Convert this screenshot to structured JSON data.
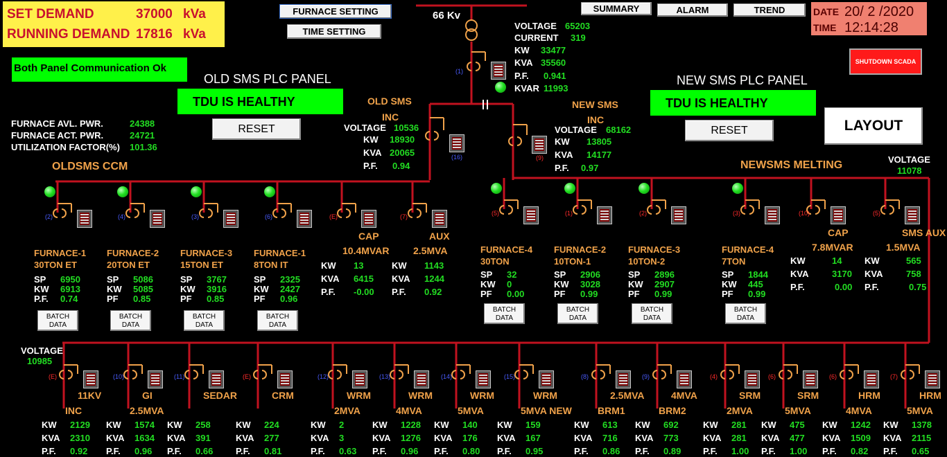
{
  "demand": {
    "set_label": "SET DEMAND",
    "set_value": "37000",
    "set_unit": "kVa",
    "run_label": "RUNNING DEMAND",
    "run_value": "17816",
    "run_unit": "kVa"
  },
  "buttons": {
    "furnace_setting": "FURNACE SETTING",
    "time_setting": "TIME SETTING",
    "summary": "SUMMARY",
    "alarm": "ALARM",
    "trend": "TREND",
    "shutdown": "SHUTDOWN SCADA",
    "layout": "LAYOUT",
    "reset_old": "RESET",
    "reset_new": "RESET"
  },
  "datetime": {
    "date_label": "DATE",
    "date_value": "20/ 2 /2020",
    "time_label": "TIME",
    "time_value": "12:14:28"
  },
  "comm_status": "Both Panel Communication Ok",
  "old_panel": {
    "title": "OLD SMS PLC PANEL",
    "status": "TDU IS HEALTHY"
  },
  "new_panel": {
    "title": "NEW SMS PLC PANEL",
    "status": "TDU IS HEALTHY"
  },
  "furnace_summary": {
    "avl_label": "FURNACE AVL. PWR.",
    "avl_value": "24388",
    "act_label": "FURNACE ACT. PWR.",
    "act_value": "24721",
    "uf_label": "UTILIZATION FACTOR(%)",
    "uf_value": "101.36"
  },
  "main_incomer": {
    "kv_label": "66 Kv",
    "breaker_no": "(1)",
    "voltage_label": "VOLTAGE",
    "voltage": "65203",
    "current_label": "CURRENT",
    "current": "319",
    "kw_label": "KW",
    "kw": "33477",
    "kva_label": "KVA",
    "kva": "35560",
    "pf_label": "P.F.",
    "pf": "0.941",
    "kvar_label": "KVAR",
    "kvar": "11993"
  },
  "old_inc": {
    "title1": "OLD SMS",
    "title2": "INC",
    "breaker_no": "(16)",
    "voltage_label": "VOLTAGE",
    "voltage": "10536",
    "kw_label": "KW",
    "kw": "18930",
    "kva_label": "KVA",
    "kva": "20065",
    "pf_label": "P.F.",
    "pf": "0.94"
  },
  "new_inc": {
    "title1": "NEW SMS",
    "title2": "INC",
    "breaker_no": "(9)",
    "voltage_label": "VOLTAGE",
    "voltage": "68162",
    "kw_label": "KW",
    "kw": "13805",
    "kva_label": "KVA",
    "kva": "14177",
    "pf_label": "P.F.",
    "pf": "0.97"
  },
  "old_ccm_title": "OLDSMS CCM",
  "new_melting": {
    "title": "NEWSMS MELTING",
    "voltage_label": "VOLTAGE",
    "voltage": "11078"
  },
  "bottom_bus": {
    "voltage_label": "VOLTAGE",
    "voltage": "10985"
  },
  "batch_label_1": "BATCH",
  "batch_label_2": "DATA",
  "furnaces": [
    {
      "no": "(2)",
      "name1": "FURNACE-1",
      "name2": "30TON ET",
      "r1l": "SP",
      "r1v": "6950",
      "r2l": "KW",
      "r2v": "6913",
      "r3l": "P.F.",
      "r3v": "0.74"
    },
    {
      "no": "(4)",
      "name1": "FURNACE-2",
      "name2": "20TON ET",
      "r1l": "SP",
      "r1v": "5086",
      "r2l": "KW",
      "r2v": "5085",
      "r3l": "PF",
      "r3v": "0.85"
    },
    {
      "no": "(3)",
      "name1": "FURNACE-3",
      "name2": "15TON ET",
      "r1l": "SP",
      "r1v": "3767",
      "r2l": "KW",
      "r2v": "3916",
      "r3l": "PF",
      "r3v": "0.85"
    },
    {
      "no": "(6)",
      "name1": "FURNACE-1",
      "name2": "8TON IT",
      "r1l": "SP",
      "r1v": "2325",
      "r2l": "KW",
      "r2v": "2427",
      "r3l": "PF",
      "r3v": "0.96"
    },
    {
      "no": "(5)",
      "name1": "FURNACE-4",
      "name2": "30TON",
      "r1l": "SP",
      "r1v": "32",
      "r2l": "KW",
      "r2v": "0",
      "r3l": "PF",
      "r3v": "0.00"
    },
    {
      "no": "(1)",
      "name1": "FURNACE-2",
      "name2": "10TON-1",
      "r1l": "SP",
      "r1v": "2906",
      "r2l": "KW",
      "r2v": "3028",
      "r3l": "PF",
      "r3v": "0.99"
    },
    {
      "no": "(2)",
      "name1": "FURNACE-3",
      "name2": "10TON-2",
      "r1l": "SP",
      "r1v": "2896",
      "r2l": "KW",
      "r2v": "2907",
      "r3l": "PF",
      "r3v": "0.99"
    },
    {
      "no": "(3)",
      "name1": "FURNACE-4",
      "name2": "7TON",
      "r1l": "SP",
      "r1v": "1844",
      "r2l": "KW",
      "r2v": "445",
      "r3l": "PF",
      "r3v": "0.99"
    }
  ],
  "aux_feeders": [
    {
      "no": "(E)",
      "name1": "CAP",
      "name2": "10.4MVAR",
      "kw": "13",
      "kva": "6415",
      "pf": "-0.00"
    },
    {
      "no": "(7)",
      "name1": "AUX",
      "name2": "2.5MVA",
      "kw": "1143",
      "kva": "1244",
      "pf": "0.92"
    },
    {
      "no": "(10)",
      "name1": "CAP",
      "name2": "7.8MVAR",
      "kw": "14",
      "kva": "3170",
      "pf": "0.00"
    },
    {
      "no": "(5)",
      "name1": "SMS AUX",
      "name2": "1.5MVA",
      "kw": "565",
      "kva": "758",
      "pf": "0.75"
    }
  ],
  "bottom_feeders": [
    {
      "no": "(E)",
      "name1": "11KV",
      "name2": "INC",
      "kw": "2129",
      "kva": "2310",
      "pf": "0.92"
    },
    {
      "no": "(10)",
      "name1": "GI",
      "name2": "2.5MVA",
      "kw": "1574",
      "kva": "1634",
      "pf": "0.96"
    },
    {
      "no": "(11)",
      "name1": "SEDAR",
      "name2": "",
      "kw": "258",
      "kva": "391",
      "pf": "0.66"
    },
    {
      "no": "(E)",
      "name1": "CRM",
      "name2": "",
      "kw": "224",
      "kva": "277",
      "pf": "0.81"
    },
    {
      "no": "(12)",
      "name1": "WRM",
      "name2": "2MVA",
      "kw": "2",
      "kva": "3",
      "pf": "0.63"
    },
    {
      "no": "(13)",
      "name1": "WRM",
      "name2": "4MVA",
      "kw": "1228",
      "kva": "1276",
      "pf": "0.96"
    },
    {
      "no": "(14)",
      "name1": "WRM",
      "name2": "5MVA",
      "kw": "140",
      "kva": "176",
      "pf": "0.80"
    },
    {
      "no": "(15)",
      "name1": "WRM",
      "name2": "5MVA NEW",
      "kw": "159",
      "kva": "167",
      "pf": "0.95"
    },
    {
      "no": "(8)",
      "name1": "2.5MVA",
      "name2": "BRM1",
      "kw": "613",
      "kva": "716",
      "pf": "0.86"
    },
    {
      "no": "(9)",
      "name1": "4MVA",
      "name2": "BRM2",
      "kw": "692",
      "kva": "773",
      "pf": "0.89"
    },
    {
      "no": "(4)",
      "name1": "SRM",
      "name2": "2MVA",
      "kw": "281",
      "kva": "281",
      "pf": "1.00"
    },
    {
      "no": "(6)",
      "name1": "SRM",
      "name2": "5MVA",
      "kw": "475",
      "kva": "477",
      "pf": "1.00"
    },
    {
      "no": "(6)",
      "name1": "HRM",
      "name2": "4MVA",
      "kw": "1242",
      "kva": "1509",
      "pf": "0.82"
    },
    {
      "no": "(7)",
      "name1": "HRM",
      "name2": "5MVA",
      "kw": "1378",
      "kva": "2115",
      "pf": "0.65"
    }
  ],
  "row_labels": {
    "kw": "KW",
    "kva": "KVA",
    "pf": "P.F."
  },
  "colors": {
    "bus": "#c1121f",
    "wire": "#f0a24a",
    "value": "#22dd22",
    "title": "#f0a24a",
    "status_bg": "#00ff00",
    "demand_bg": "#fff04a",
    "datetime_bg": "#f08070"
  }
}
